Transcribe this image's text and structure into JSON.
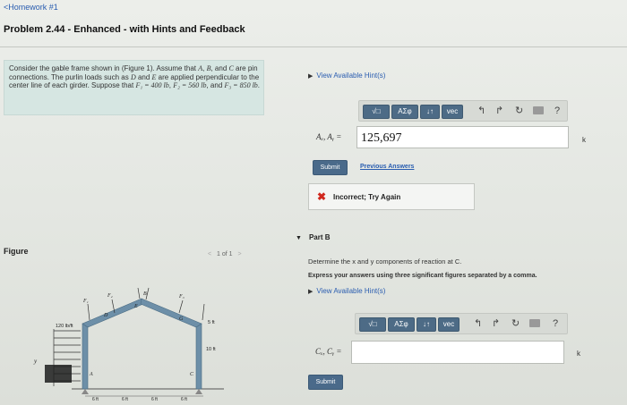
{
  "header": {
    "back_link": "<Homework #1",
    "problem_title": "Problem 2.44 - Enhanced - with Hints and Feedback"
  },
  "problem": {
    "text_parts": [
      "Consider the gable frame shown in (",
      "Figure 1",
      "). Assume that ",
      "A",
      ", ",
      "B",
      ", and ",
      "C",
      " are pin connections. The purlin loads such as ",
      "D",
      " and ",
      "E",
      " are applied perpendicular to the center line of each girder. Suppose that ",
      "F₁ = 400 lb",
      ", ",
      "F₂ = 560 lb",
      ", and ",
      "F₃ = 850 lb",
      "."
    ]
  },
  "toolbar": {
    "sqrt_label": "√□",
    "greek_label": "AΣφ",
    "arrows_label": "↓↑",
    "vec_label": "vec",
    "undo_icon": "↰",
    "redo_icon": "↱",
    "reset_icon": "↻",
    "help_icon": "?"
  },
  "part_a": {
    "hint_link": "View Available Hint(s)",
    "variable_label": "Aₓ, Aᵧ =",
    "answer_value": "125,697",
    "unit": "k",
    "submit_label": "Submit",
    "previous_answers_label": "Previous Answers",
    "feedback_icon": "✖",
    "feedback_text": "Incorrect; Try Again"
  },
  "part_b": {
    "title": "Part B",
    "prompt": "Determine the x and y components of reaction at C.",
    "instructions": "Express your answers using three significant figures separated by a comma.",
    "hint_link": "View Available Hint(s)",
    "variable_label": "Cₓ, Cᵧ =",
    "answer_value": "",
    "unit": "k",
    "submit_label": "Submit"
  },
  "figure": {
    "label": "Figure",
    "pager_text": "1 of 1",
    "prev_arrow": "<",
    "next_arrow": ">",
    "labels": {
      "load": "120 lb/ft",
      "y_axis": "y",
      "height_top": "5 ft",
      "height_side": "10 ft",
      "spacing": "6 ft",
      "D": "D",
      "E": "E",
      "B": "B",
      "G": "G",
      "A": "A",
      "C": "C",
      "F1": "F₁",
      "F2": "F₂",
      "F3": "F₃"
    }
  },
  "colors": {
    "link": "#2a5db0",
    "submit": "#4a6a8a",
    "incorrect": "#d0271d",
    "problem_box": "#d6e6e2"
  }
}
